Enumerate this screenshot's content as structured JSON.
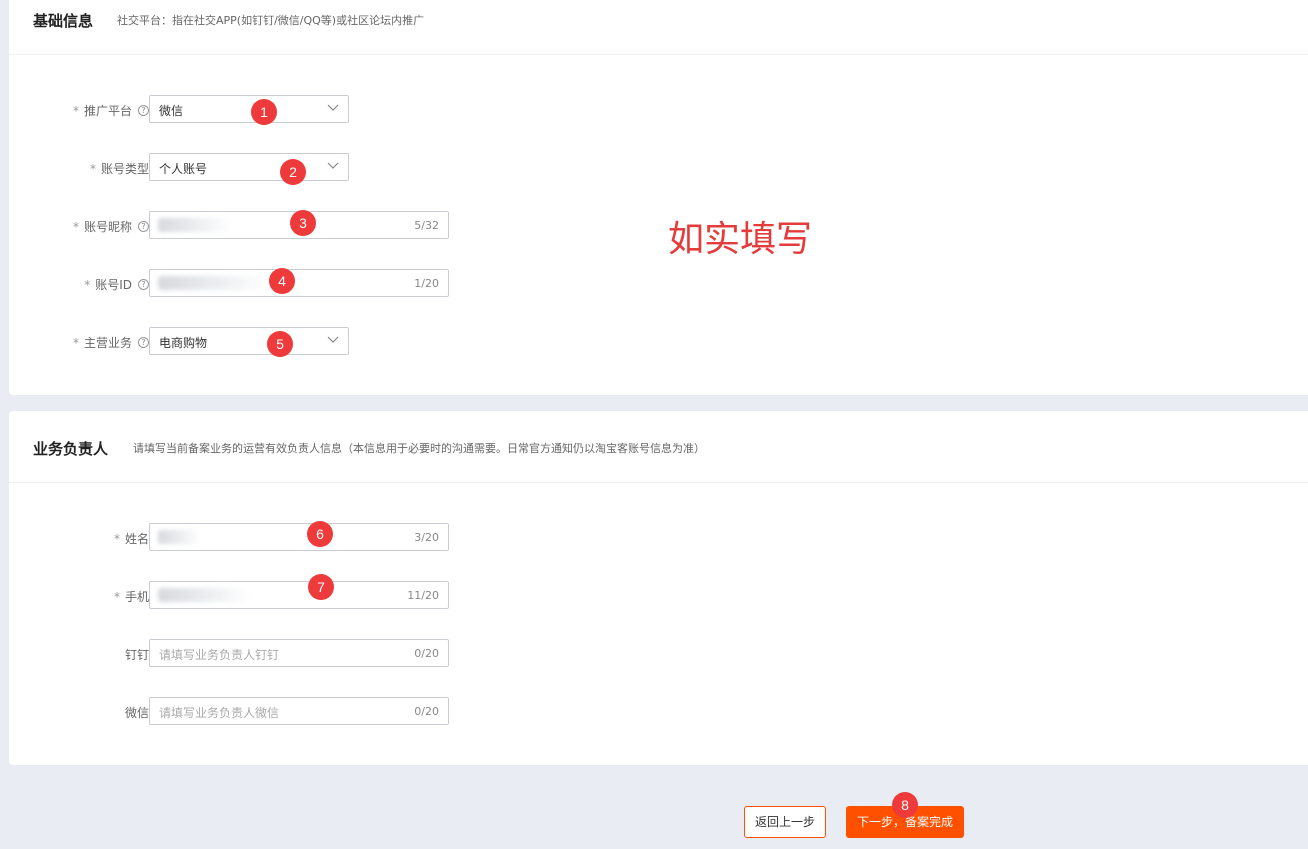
{
  "basic_section": {
    "title": "基础信息",
    "description": "社交平台：指在社交APP(如钉钉/微信/QQ等)或社区论坛内推广",
    "fields": [
      {
        "label": "推广平台",
        "required": "*",
        "value": "微信",
        "kind": "select"
      },
      {
        "label": "账号类型",
        "required": "*",
        "value": "个人账号",
        "kind": "select"
      },
      {
        "label": "账号昵称",
        "required": "*",
        "value": "",
        "counter": "5/32",
        "kind": "input"
      },
      {
        "label": "账号ID",
        "required": "*",
        "value": "",
        "counter": "1/20",
        "kind": "input"
      },
      {
        "label": "主营业务",
        "required": "*",
        "value": "电商购物",
        "kind": "select"
      }
    ]
  },
  "owner_section": {
    "title": "业务负责人",
    "description": "请填写当前备案业务的运营有效负责人信息（本信息用于必要时的沟通需要。日常官方通知仍以淘宝客账号信息为准）",
    "fields": [
      {
        "label": "姓名",
        "required": "*",
        "value": "",
        "counter": "3/20"
      },
      {
        "label": "手机",
        "required": "*",
        "value": "",
        "counter": "11/20"
      },
      {
        "label": "钉钉",
        "required": "",
        "placeholder": "请填写业务负责人钉钉",
        "counter": "0/20"
      },
      {
        "label": "微信",
        "required": "",
        "placeholder": "请填写业务负责人微信",
        "counter": "0/20"
      }
    ]
  },
  "annotation": "如实填写",
  "badges": [
    "1",
    "2",
    "3",
    "4",
    "5",
    "6",
    "7",
    "8"
  ],
  "help_icon_glyph": "?",
  "buttons": {
    "prev": "返回上一步",
    "next": "下一步，备案完成"
  },
  "colors": {
    "primary": "#ff5000",
    "badge": "#ee3a3a",
    "annotation": "#e53b3b",
    "page_bg": "#e9ecf3"
  }
}
